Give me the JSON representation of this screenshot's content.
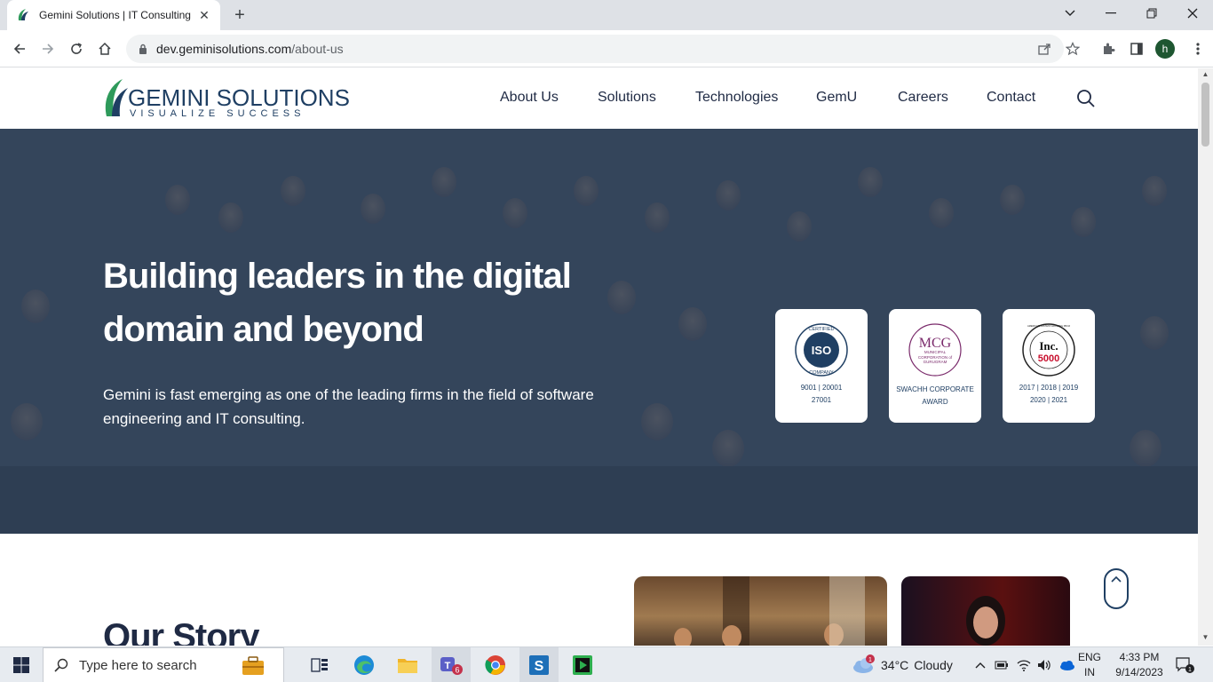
{
  "browser": {
    "tab_title": "Gemini Solutions | IT Consulting, ...",
    "url_host": "dev.geminisolutions.com",
    "url_path": "/about-us",
    "profile_initial": "h"
  },
  "site": {
    "logo_brand": "GEMINI SOLUTIONS",
    "logo_tagline": "VISUALIZE SUCCESS",
    "nav": [
      "About Us",
      "Solutions",
      "Technologies",
      "GemU",
      "Careers",
      "Contact"
    ]
  },
  "hero": {
    "title": "Building leaders in the digital domain and beyond",
    "description": "Gemini is fast emerging as one of the leading firms in the field of software engineering and IT consulting.",
    "badges": [
      {
        "logo_text": "ISO",
        "ring_top": "CERTIFIED",
        "ring_bottom": "COMPANY",
        "caption_line1": "9001 | 20001",
        "caption_line2": "27001"
      },
      {
        "logo_text": "MCG",
        "sub": "MUNICIPAL CORPORATION of GURUGRAM",
        "caption_line1": "SWACHH CORPORATE",
        "caption_line2": "AWARD"
      },
      {
        "logo_text": "Inc.",
        "logo_num": "5000",
        "ring_text": "AMERICA'S FASTEST-GROWING PRIVATE COMPANIES",
        "caption_line1": "2017 | 2018 | 2019",
        "caption_line2": "2020 | 2021"
      }
    ]
  },
  "story": {
    "title": "Our Story"
  },
  "taskbar": {
    "search_placeholder": "Type here to search",
    "weather_temp": "34°C",
    "weather_desc": "Cloudy",
    "weather_badge": "1",
    "lang_line1": "ENG",
    "lang_line2": "IN",
    "time": "4:33 PM",
    "date": "9/14/2023",
    "teams_badge": "6",
    "notification_count": "1"
  },
  "colors": {
    "brand_navy": "#1f3f63",
    "brand_green": "#2e9a5b",
    "profile": "#1e5631"
  }
}
